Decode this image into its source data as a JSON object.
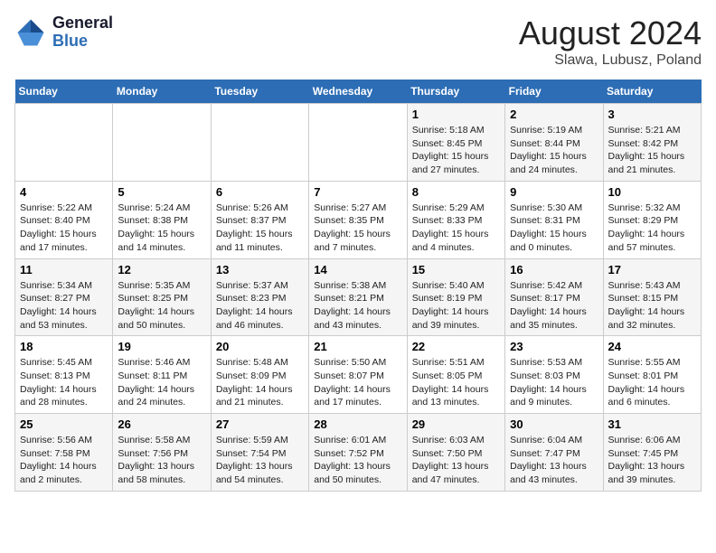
{
  "header": {
    "logo_line1": "General",
    "logo_line2": "Blue",
    "title": "August 2024",
    "subtitle": "Slawa, Lubusz, Poland"
  },
  "weekdays": [
    "Sunday",
    "Monday",
    "Tuesday",
    "Wednesday",
    "Thursday",
    "Friday",
    "Saturday"
  ],
  "weeks": [
    [
      {
        "day": "",
        "content": ""
      },
      {
        "day": "",
        "content": ""
      },
      {
        "day": "",
        "content": ""
      },
      {
        "day": "",
        "content": ""
      },
      {
        "day": "1",
        "content": "Sunrise: 5:18 AM\nSunset: 8:45 PM\nDaylight: 15 hours and 27 minutes."
      },
      {
        "day": "2",
        "content": "Sunrise: 5:19 AM\nSunset: 8:44 PM\nDaylight: 15 hours and 24 minutes."
      },
      {
        "day": "3",
        "content": "Sunrise: 5:21 AM\nSunset: 8:42 PM\nDaylight: 15 hours and 21 minutes."
      }
    ],
    [
      {
        "day": "4",
        "content": "Sunrise: 5:22 AM\nSunset: 8:40 PM\nDaylight: 15 hours and 17 minutes."
      },
      {
        "day": "5",
        "content": "Sunrise: 5:24 AM\nSunset: 8:38 PM\nDaylight: 15 hours and 14 minutes."
      },
      {
        "day": "6",
        "content": "Sunrise: 5:26 AM\nSunset: 8:37 PM\nDaylight: 15 hours and 11 minutes."
      },
      {
        "day": "7",
        "content": "Sunrise: 5:27 AM\nSunset: 8:35 PM\nDaylight: 15 hours and 7 minutes."
      },
      {
        "day": "8",
        "content": "Sunrise: 5:29 AM\nSunset: 8:33 PM\nDaylight: 15 hours and 4 minutes."
      },
      {
        "day": "9",
        "content": "Sunrise: 5:30 AM\nSunset: 8:31 PM\nDaylight: 15 hours and 0 minutes."
      },
      {
        "day": "10",
        "content": "Sunrise: 5:32 AM\nSunset: 8:29 PM\nDaylight: 14 hours and 57 minutes."
      }
    ],
    [
      {
        "day": "11",
        "content": "Sunrise: 5:34 AM\nSunset: 8:27 PM\nDaylight: 14 hours and 53 minutes."
      },
      {
        "day": "12",
        "content": "Sunrise: 5:35 AM\nSunset: 8:25 PM\nDaylight: 14 hours and 50 minutes."
      },
      {
        "day": "13",
        "content": "Sunrise: 5:37 AM\nSunset: 8:23 PM\nDaylight: 14 hours and 46 minutes."
      },
      {
        "day": "14",
        "content": "Sunrise: 5:38 AM\nSunset: 8:21 PM\nDaylight: 14 hours and 43 minutes."
      },
      {
        "day": "15",
        "content": "Sunrise: 5:40 AM\nSunset: 8:19 PM\nDaylight: 14 hours and 39 minutes."
      },
      {
        "day": "16",
        "content": "Sunrise: 5:42 AM\nSunset: 8:17 PM\nDaylight: 14 hours and 35 minutes."
      },
      {
        "day": "17",
        "content": "Sunrise: 5:43 AM\nSunset: 8:15 PM\nDaylight: 14 hours and 32 minutes."
      }
    ],
    [
      {
        "day": "18",
        "content": "Sunrise: 5:45 AM\nSunset: 8:13 PM\nDaylight: 14 hours and 28 minutes."
      },
      {
        "day": "19",
        "content": "Sunrise: 5:46 AM\nSunset: 8:11 PM\nDaylight: 14 hours and 24 minutes."
      },
      {
        "day": "20",
        "content": "Sunrise: 5:48 AM\nSunset: 8:09 PM\nDaylight: 14 hours and 21 minutes."
      },
      {
        "day": "21",
        "content": "Sunrise: 5:50 AM\nSunset: 8:07 PM\nDaylight: 14 hours and 17 minutes."
      },
      {
        "day": "22",
        "content": "Sunrise: 5:51 AM\nSunset: 8:05 PM\nDaylight: 14 hours and 13 minutes."
      },
      {
        "day": "23",
        "content": "Sunrise: 5:53 AM\nSunset: 8:03 PM\nDaylight: 14 hours and 9 minutes."
      },
      {
        "day": "24",
        "content": "Sunrise: 5:55 AM\nSunset: 8:01 PM\nDaylight: 14 hours and 6 minutes."
      }
    ],
    [
      {
        "day": "25",
        "content": "Sunrise: 5:56 AM\nSunset: 7:58 PM\nDaylight: 14 hours and 2 minutes."
      },
      {
        "day": "26",
        "content": "Sunrise: 5:58 AM\nSunset: 7:56 PM\nDaylight: 13 hours and 58 minutes."
      },
      {
        "day": "27",
        "content": "Sunrise: 5:59 AM\nSunset: 7:54 PM\nDaylight: 13 hours and 54 minutes."
      },
      {
        "day": "28",
        "content": "Sunrise: 6:01 AM\nSunset: 7:52 PM\nDaylight: 13 hours and 50 minutes."
      },
      {
        "day": "29",
        "content": "Sunrise: 6:03 AM\nSunset: 7:50 PM\nDaylight: 13 hours and 47 minutes."
      },
      {
        "day": "30",
        "content": "Sunrise: 6:04 AM\nSunset: 7:47 PM\nDaylight: 13 hours and 43 minutes."
      },
      {
        "day": "31",
        "content": "Sunrise: 6:06 AM\nSunset: 7:45 PM\nDaylight: 13 hours and 39 minutes."
      }
    ]
  ]
}
